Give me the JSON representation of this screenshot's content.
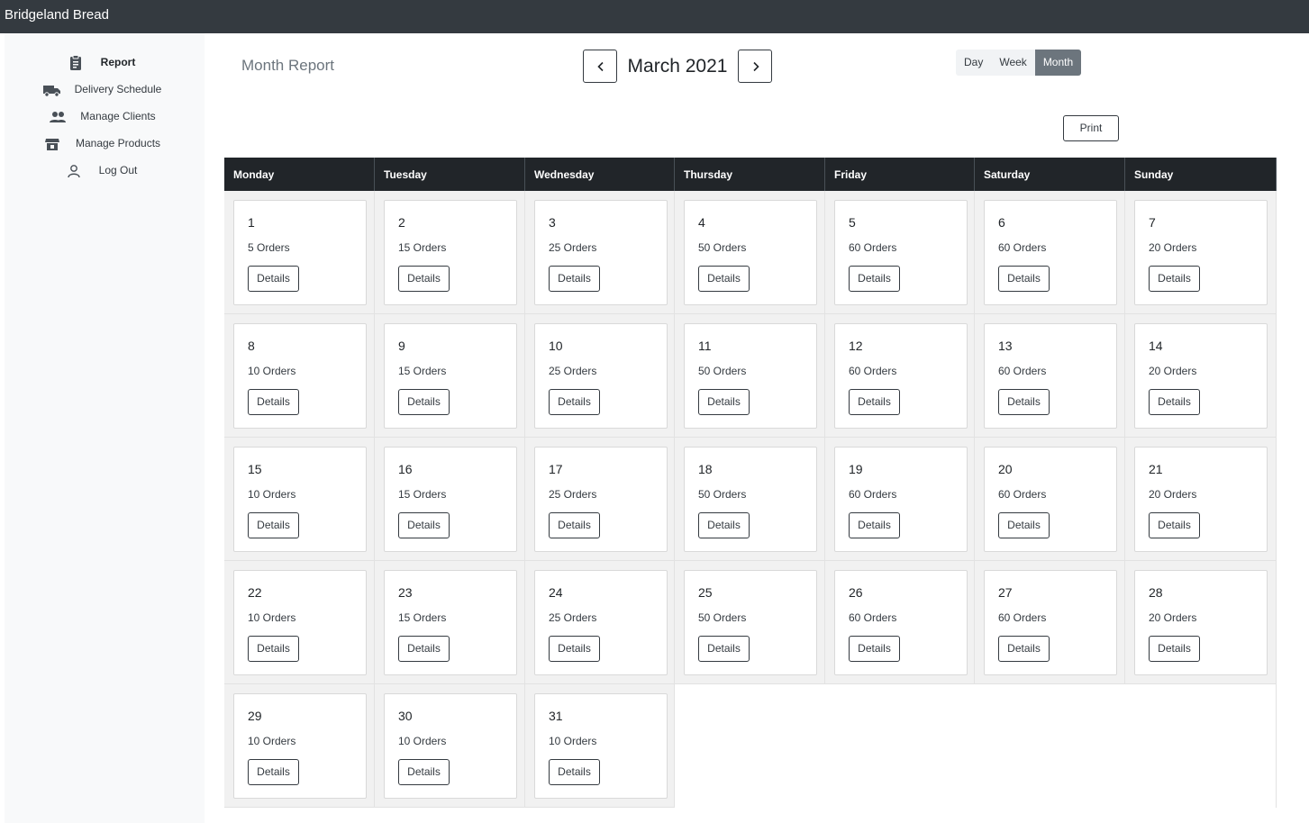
{
  "app": {
    "brand": "Bridgeland Bread"
  },
  "sidebar": {
    "items": [
      {
        "label": "Report",
        "icon": "clipboard-icon",
        "active": true
      },
      {
        "label": "Delivery Schedule",
        "icon": "truck-icon",
        "active": false
      },
      {
        "label": "Manage Clients",
        "icon": "people-icon",
        "active": false
      },
      {
        "label": "Manage Products",
        "icon": "store-icon",
        "active": false
      },
      {
        "label": "Log Out",
        "icon": "person-icon",
        "active": false
      }
    ]
  },
  "header": {
    "title": "Month Report",
    "month_label": "March 2021",
    "prev_icon": "chevron-left-icon",
    "next_icon": "chevron-right-icon",
    "views": [
      {
        "label": "Day",
        "active": false
      },
      {
        "label": "Week",
        "active": false
      },
      {
        "label": "Month",
        "active": true
      }
    ],
    "print_label": "Print"
  },
  "calendar": {
    "weekdays": [
      "Monday",
      "Tuesday",
      "Wednesday",
      "Thursday",
      "Friday",
      "Saturday",
      "Sunday"
    ],
    "details_label": "Details",
    "days": [
      {
        "day": "1",
        "orders": "5 Orders"
      },
      {
        "day": "2",
        "orders": "15 Orders"
      },
      {
        "day": "3",
        "orders": "25 Orders"
      },
      {
        "day": "4",
        "orders": "50 Orders"
      },
      {
        "day": "5",
        "orders": "60 Orders"
      },
      {
        "day": "6",
        "orders": "60 Orders"
      },
      {
        "day": "7",
        "orders": "20 Orders"
      },
      {
        "day": "8",
        "orders": "10 Orders"
      },
      {
        "day": "9",
        "orders": "15 Orders"
      },
      {
        "day": "10",
        "orders": "25 Orders"
      },
      {
        "day": "11",
        "orders": "50 Orders"
      },
      {
        "day": "12",
        "orders": "60 Orders"
      },
      {
        "day": "13",
        "orders": "60 Orders"
      },
      {
        "day": "14",
        "orders": "20 Orders"
      },
      {
        "day": "15",
        "orders": "10 Orders"
      },
      {
        "day": "16",
        "orders": "15 Orders"
      },
      {
        "day": "17",
        "orders": "25 Orders"
      },
      {
        "day": "18",
        "orders": "50 Orders"
      },
      {
        "day": "19",
        "orders": "60 Orders"
      },
      {
        "day": "20",
        "orders": "60 Orders"
      },
      {
        "day": "21",
        "orders": "20 Orders"
      },
      {
        "day": "22",
        "orders": "10 Orders"
      },
      {
        "day": "23",
        "orders": "15 Orders"
      },
      {
        "day": "24",
        "orders": "25 Orders"
      },
      {
        "day": "25",
        "orders": "50 Orders"
      },
      {
        "day": "26",
        "orders": "60 Orders"
      },
      {
        "day": "27",
        "orders": "60 Orders"
      },
      {
        "day": "28",
        "orders": "20 Orders"
      },
      {
        "day": "29",
        "orders": "10 Orders"
      },
      {
        "day": "30",
        "orders": "10 Orders"
      },
      {
        "day": "31",
        "orders": "10 Orders"
      }
    ]
  }
}
